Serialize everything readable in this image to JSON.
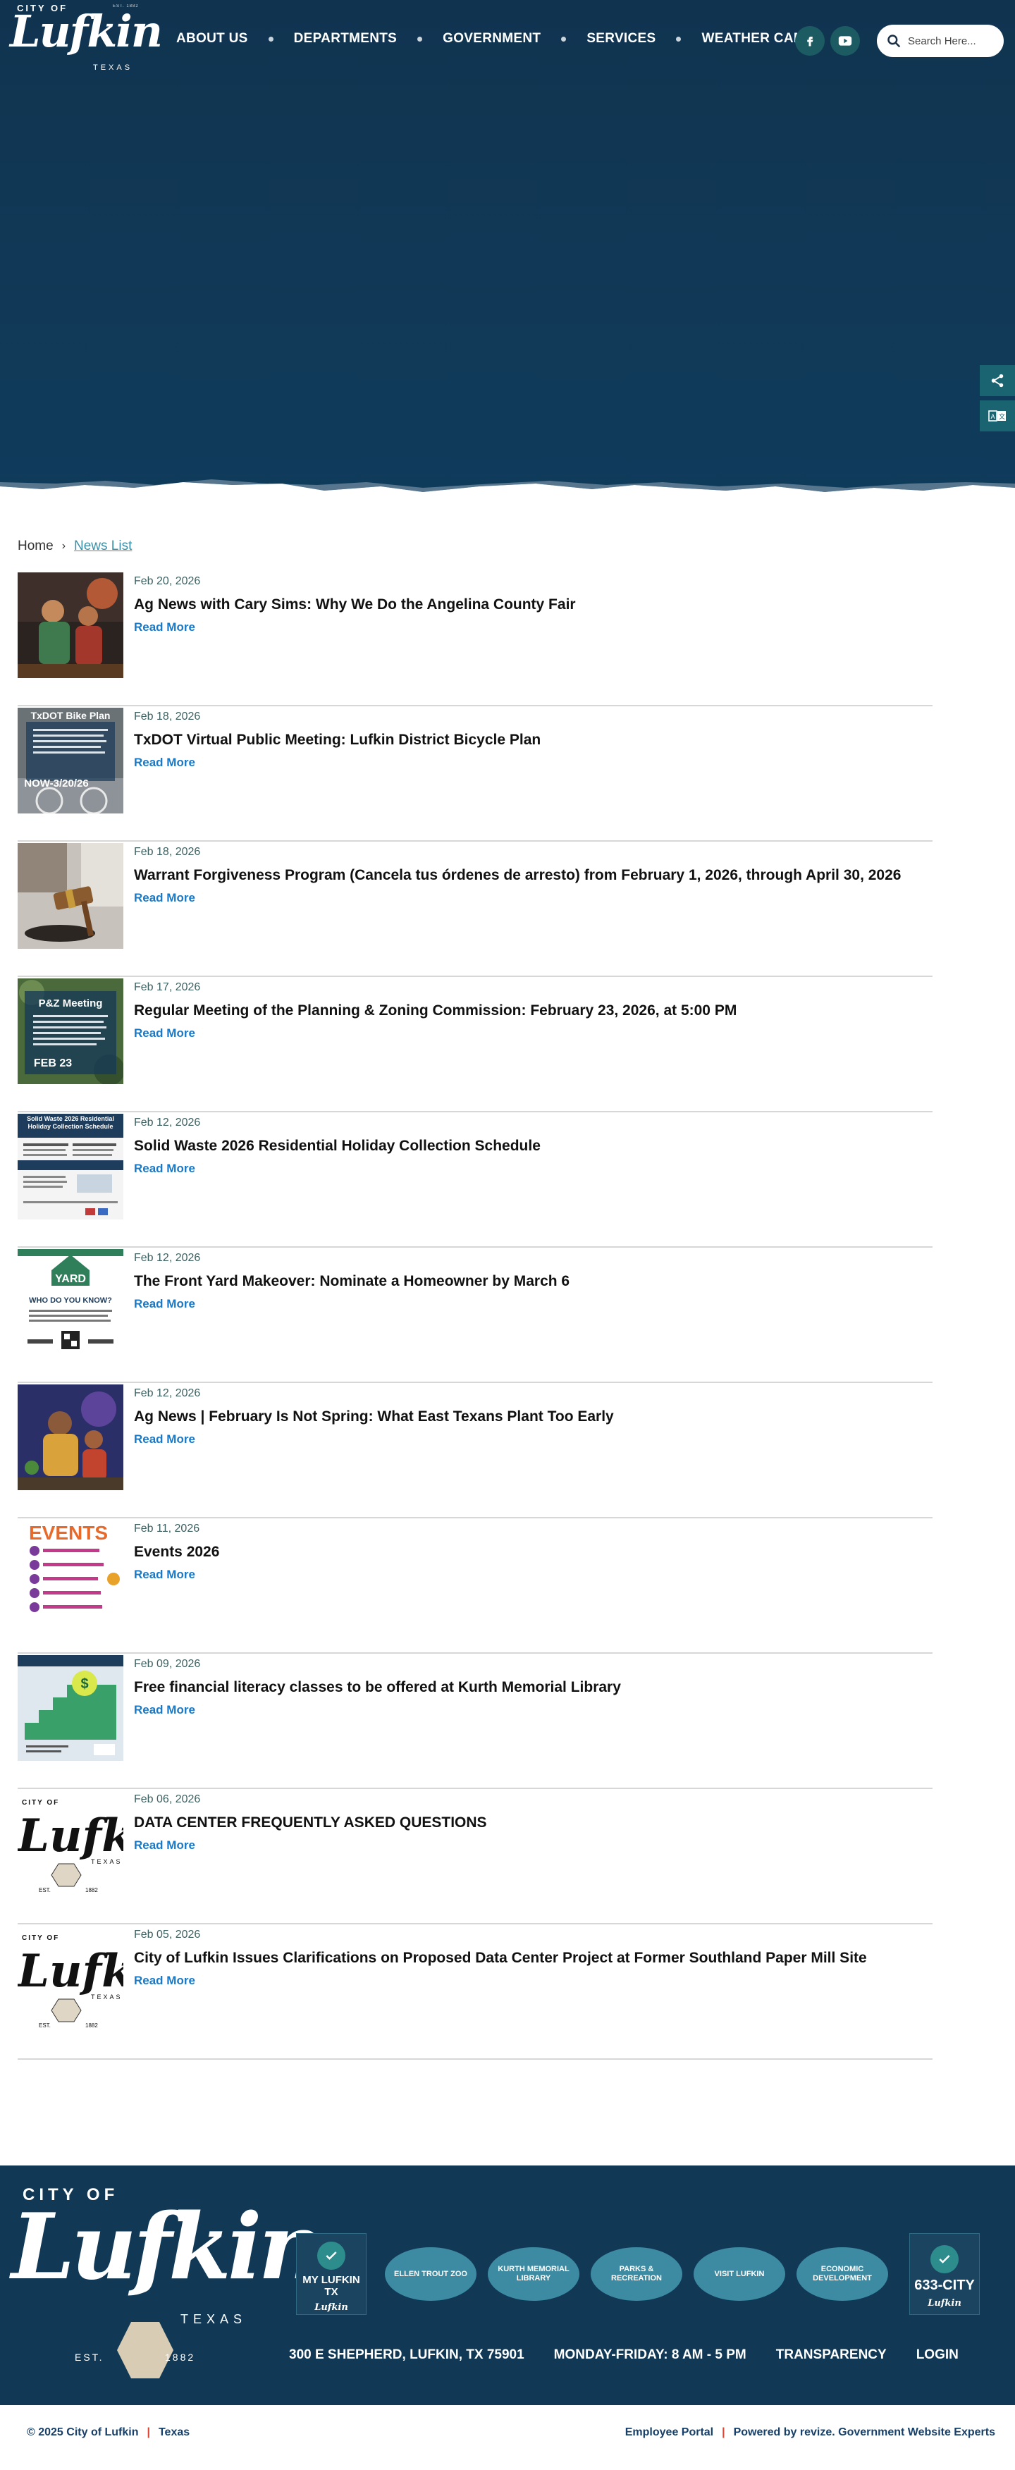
{
  "header": {
    "logo": {
      "city": "CITY OF",
      "name": "Lufkin",
      "state": "TEXAS",
      "est": "EST. 1882"
    },
    "nav": [
      "ABOUT US",
      "DEPARTMENTS",
      "GOVERNMENT",
      "SERVICES",
      "WEATHER CAM"
    ],
    "social": [
      "facebook-icon",
      "youtube-icon"
    ],
    "search": {
      "placeholder": "Search Here..."
    }
  },
  "sidetabs": [
    "share-icon",
    "translate-icon"
  ],
  "breadcrumb": {
    "home": "Home",
    "separator": "›",
    "current": "News List"
  },
  "news": [
    {
      "date": "Feb 20, 2026",
      "title": "Ag News with Cary Sims: Why We Do the Angelina County Fair",
      "more": "Read More",
      "thumb": "fair-illustration"
    },
    {
      "date": "Feb 18, 2026",
      "title": "TxDOT Virtual Public Meeting: Lufkin District Bicycle Plan",
      "more": "Read More",
      "thumb": "bike-plan",
      "thumb_text": "TxDOT Bike Plan",
      "thumb_sub": "NOW-3/20/26"
    },
    {
      "date": "Feb 18, 2026",
      "title": "Warrant Forgiveness Program (Cancela tus órdenes de arresto) from February 1, 2026, through April 30, 2026",
      "more": "Read More",
      "thumb": "gavel"
    },
    {
      "date": "Feb 17, 2026",
      "title": "Regular Meeting of the Planning & Zoning Commission: February 23, 2026, at 5:00 PM",
      "more": "Read More",
      "thumb": "pz-meeting",
      "thumb_text": "P&Z Meeting",
      "thumb_sub": "FEB 23"
    },
    {
      "date": "Feb 12, 2026",
      "title": "Solid Waste 2026 Residential Holiday Collection Schedule",
      "more": "Read More",
      "thumb": "solid-waste",
      "thumb_text": "Solid Waste 2026 Residential Holiday Collection Schedule"
    },
    {
      "date": "Feb 12, 2026",
      "title": "The Front Yard Makeover: Nominate a Homeowner by March 6",
      "more": "Read More",
      "thumb": "yard-makeover",
      "thumb_text": "YARD",
      "thumb_sub": "WHO DO YOU KNOW?"
    },
    {
      "date": "Feb 12, 2026",
      "title": "Ag News | February Is Not Spring: What East Texans Plant Too Early",
      "more": "Read More",
      "thumb": "garden-illustration"
    },
    {
      "date": "Feb 11, 2026",
      "title": "Events 2026",
      "more": "Read More",
      "thumb": "events",
      "thumb_text": "EVENTS"
    },
    {
      "date": "Feb 09, 2026",
      "title": "Free financial literacy classes to be offered at Kurth Memorial Library",
      "more": "Read More",
      "thumb": "financial"
    },
    {
      "date": "Feb 06, 2026",
      "title": "DATA CENTER FREQUENTLY ASKED QUESTIONS",
      "more": "Read More",
      "thumb": "lufkin-logo"
    },
    {
      "date": "Feb 05, 2026",
      "title": "City of Lufkin Issues Clarifications on Proposed Data Center Project at Former Southland Paper Mill Site",
      "more": "Read More",
      "thumb": "lufkin-logo"
    }
  ],
  "footer": {
    "logo": {
      "city": "CITY OF",
      "name": "Lufkin",
      "state": "TEXAS",
      "est": "EST.",
      "year": "1882"
    },
    "quicklinks": {
      "app": {
        "label": "MY LUFKIN TX",
        "sub": "Lufkin"
      },
      "ovals": [
        "ELLEN TROUT ZOO",
        "KURTH MEMORIAL LIBRARY",
        "PARKS & RECREATION",
        "VISIT LUFKIN",
        "ECONOMIC DEVELOPMENT"
      ],
      "city": {
        "label": "633-CITY",
        "sub": "Lufkin"
      }
    },
    "address": "300 E SHEPHERD, LUFKIN, TX 75901",
    "hours": "MONDAY-FRIDAY: 8 AM - 5 PM",
    "transparency": "TRANSPARENCY",
    "login": "LOGIN"
  },
  "bottom": {
    "copyright": "© 2025 City of Lufkin",
    "texas": "Texas",
    "portal": "Employee Portal",
    "powered": "Powered by revize. Government Website Experts"
  },
  "colors": {
    "navy": "#113956",
    "teal": "#1d5b63",
    "link": "#1879c7"
  }
}
